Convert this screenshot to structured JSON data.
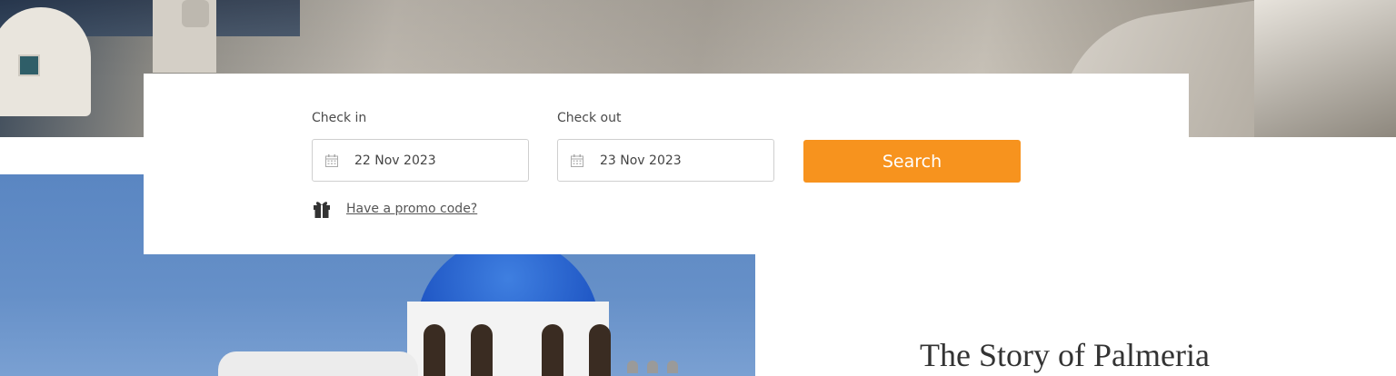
{
  "booking": {
    "check_in": {
      "label": "Check in",
      "value": "22 Nov 2023",
      "icon": "calendar-icon"
    },
    "check_out": {
      "label": "Check out",
      "value": "23 Nov 2023",
      "icon": "calendar-icon"
    },
    "search_label": "Search",
    "promo_label": "Have a promo code?",
    "promo_icon": "gift-icon"
  },
  "story": {
    "title": "The Story of Palmeria"
  },
  "colors": {
    "accent": "#f7931e",
    "panel": "#ffffff",
    "text": "#4a4a4a"
  }
}
